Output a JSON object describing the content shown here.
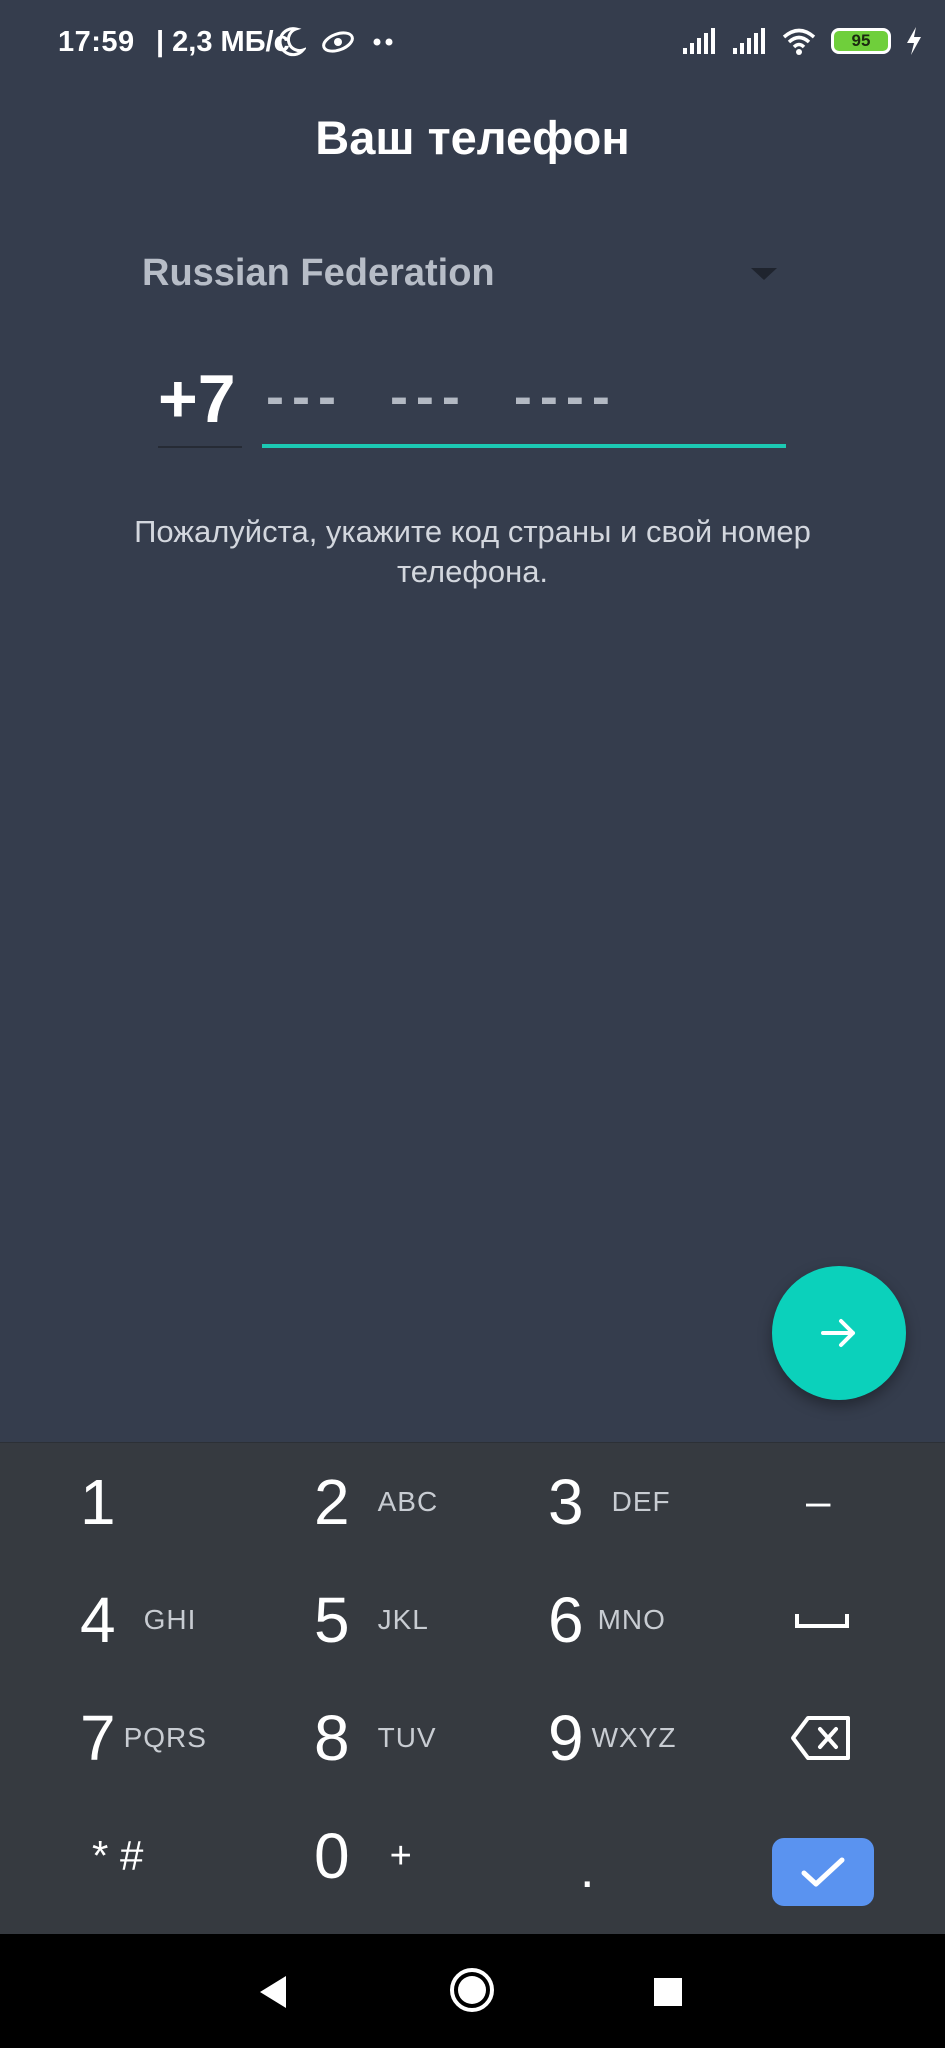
{
  "status_bar": {
    "time": "17:59",
    "speed": "| 2,3 МБ/с",
    "battery_level": "95",
    "icons": [
      "moon-icon",
      "app-notification-icon",
      "more-dots-icon",
      "signal-icon",
      "signal-icon",
      "wifi-icon",
      "battery-icon",
      "charging-icon"
    ]
  },
  "title": "Ваш телефон",
  "country": {
    "name": "Russian Federation"
  },
  "phone": {
    "code": "+7",
    "placeholder": "---  ---  ----"
  },
  "hint": "Пожалуйста, укажите код страны и свой номер телефона.",
  "keypad": {
    "keys": [
      {
        "digit": "1",
        "letters": ""
      },
      {
        "digit": "2",
        "letters": "ABC"
      },
      {
        "digit": "3",
        "letters": "DEF"
      },
      {
        "digit": "4",
        "letters": "GHI"
      },
      {
        "digit": "5",
        "letters": "JKL"
      },
      {
        "digit": "6",
        "letters": "MNO"
      },
      {
        "digit": "7",
        "letters": "PQRS"
      },
      {
        "digit": "8",
        "letters": "TUV"
      },
      {
        "digit": "9",
        "letters": "WXYZ"
      },
      {
        "digit": "0",
        "letters": "+"
      }
    ],
    "dash": "–",
    "star_hash": "* #",
    "dot": "."
  },
  "colors": {
    "background": "#353d4d",
    "accent": "#1cc9b3",
    "fab": "#0bd1bb",
    "keypad_bg": "#363a40",
    "ok_button": "#5a93f0"
  }
}
